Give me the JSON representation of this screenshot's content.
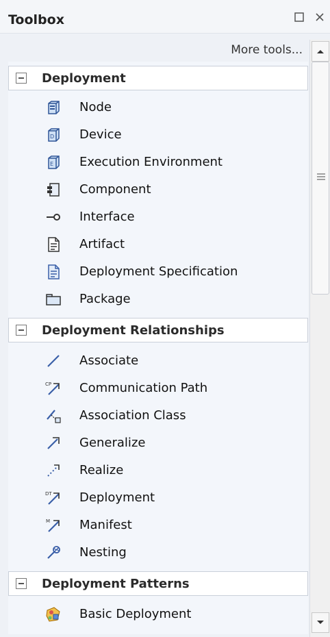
{
  "window": {
    "title": "Toolbox",
    "more_tools": "More tools..."
  },
  "sections": [
    {
      "label": "Deployment",
      "items": [
        {
          "label": "Node",
          "icon": "node-icon"
        },
        {
          "label": "Device",
          "icon": "device-icon"
        },
        {
          "label": "Execution Environment",
          "icon": "execution-environment-icon"
        },
        {
          "label": "Component",
          "icon": "component-icon"
        },
        {
          "label": "Interface",
          "icon": "interface-icon"
        },
        {
          "label": "Artifact",
          "icon": "artifact-icon"
        },
        {
          "label": "Deployment Specification",
          "icon": "deployment-specification-icon"
        },
        {
          "label": "Package",
          "icon": "package-icon"
        }
      ]
    },
    {
      "label": "Deployment Relationships",
      "items": [
        {
          "label": "Associate",
          "icon": "associate-icon"
        },
        {
          "label": "Communication Path",
          "icon": "communication-path-icon"
        },
        {
          "label": "Association Class",
          "icon": "association-class-icon"
        },
        {
          "label": "Generalize",
          "icon": "generalize-icon"
        },
        {
          "label": "Realize",
          "icon": "realize-icon"
        },
        {
          "label": "Deployment",
          "icon": "deployment-icon"
        },
        {
          "label": "Manifest",
          "icon": "manifest-icon"
        },
        {
          "label": "Nesting",
          "icon": "nesting-icon"
        }
      ]
    },
    {
      "label": "Deployment Patterns",
      "items": [
        {
          "label": "Basic Deployment",
          "icon": "basic-deployment-icon"
        }
      ]
    }
  ],
  "colors": {
    "background": "#eef1f6",
    "header": "#ffffff",
    "border": "#c9cfd9",
    "icon_blue": "#3a5fa8"
  }
}
